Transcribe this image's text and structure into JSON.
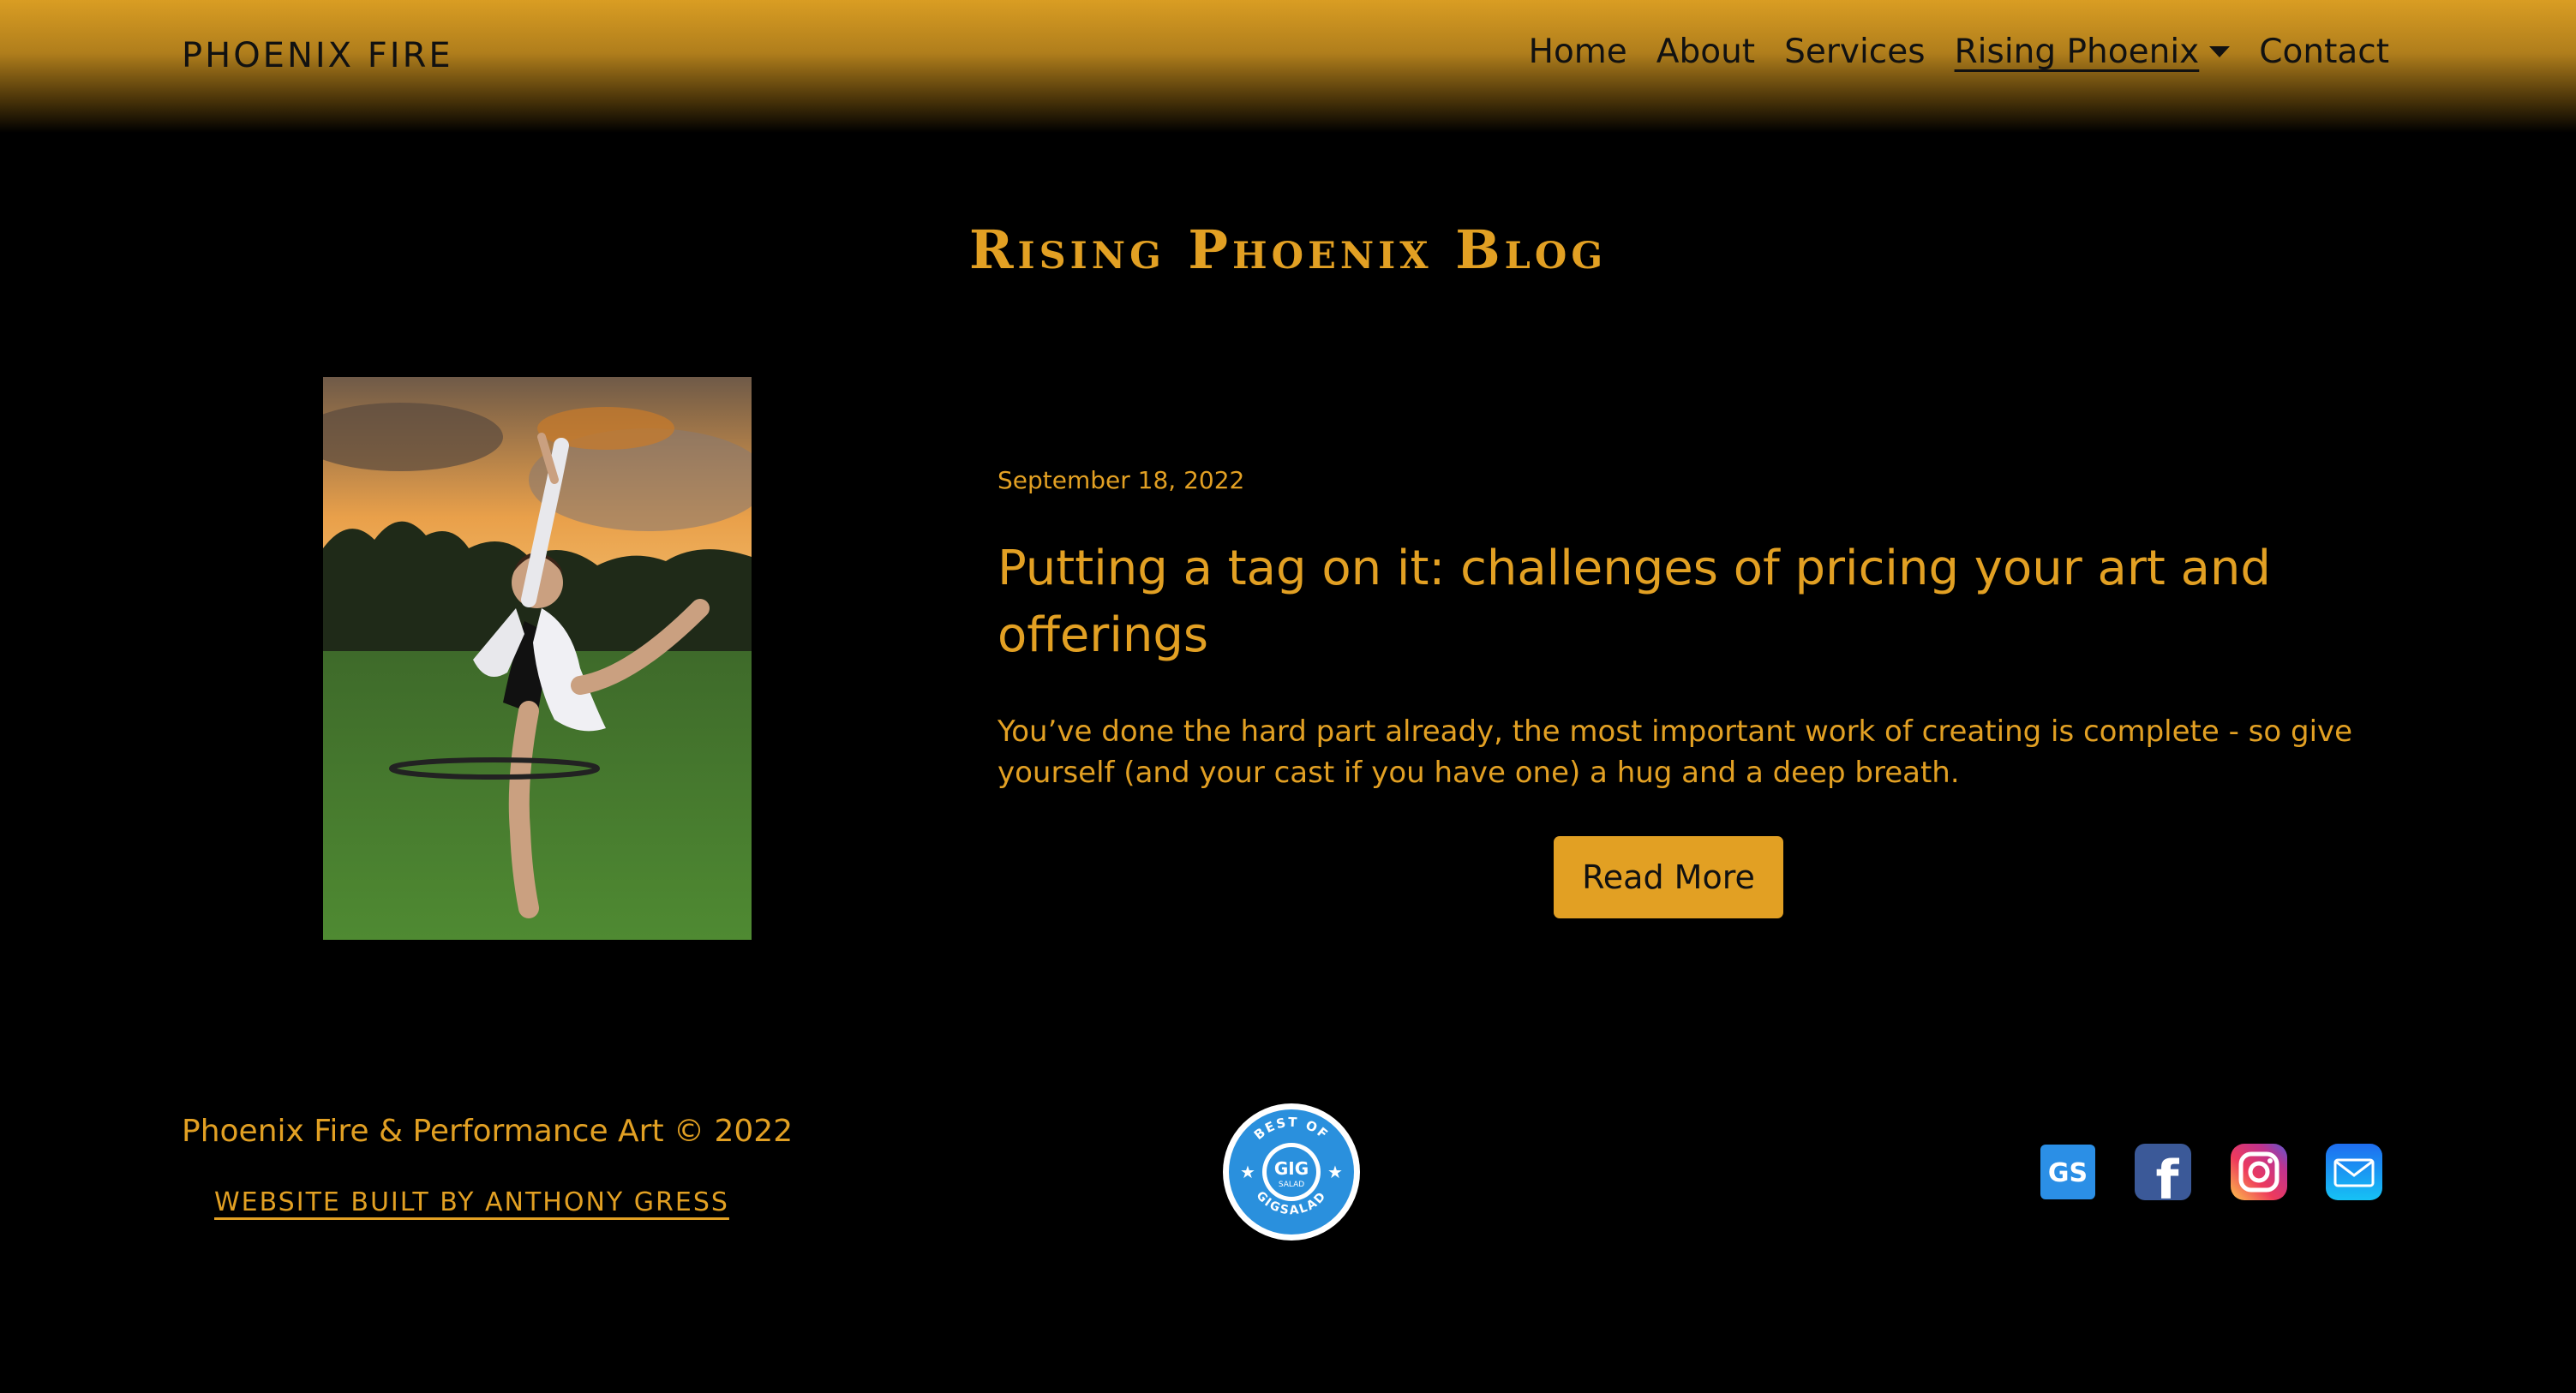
{
  "navbar": {
    "brand": "PHOENIX FIRE",
    "links": [
      {
        "label": "Home"
      },
      {
        "label": "About"
      },
      {
        "label": "Services"
      },
      {
        "label": "Rising Phoenix",
        "active": true,
        "dropdown": true
      },
      {
        "label": "Contact"
      }
    ]
  },
  "page": {
    "title": "Rising Phoenix Blog"
  },
  "post": {
    "date": "September 18, 2022",
    "title": "Putting a tag on it: challenges of pricing your art and offerings",
    "excerpt": "You’ve done the hard part already, the most important work of creating is complete - so give yourself (and your cast if you have one) a hug and a deep breath.",
    "read_more_label": "Read More"
  },
  "footer": {
    "copyright": "Phoenix Fire & Performance Art © 2022",
    "builder_link": "Website built by Anthony Gress",
    "badge": {
      "top_text": "BEST OF",
      "center_text": "GIG",
      "center_sub": "SALAD",
      "bottom_text": "GIGSALAD"
    },
    "social": [
      {
        "icon": "gigsalad-icon",
        "text": "GS"
      },
      {
        "icon": "facebook-icon",
        "text": "f"
      },
      {
        "icon": "instagram-icon"
      },
      {
        "icon": "email-icon"
      }
    ]
  },
  "colors": {
    "accent": "#e2a023",
    "background": "#000000",
    "nav_text": "#111111"
  }
}
